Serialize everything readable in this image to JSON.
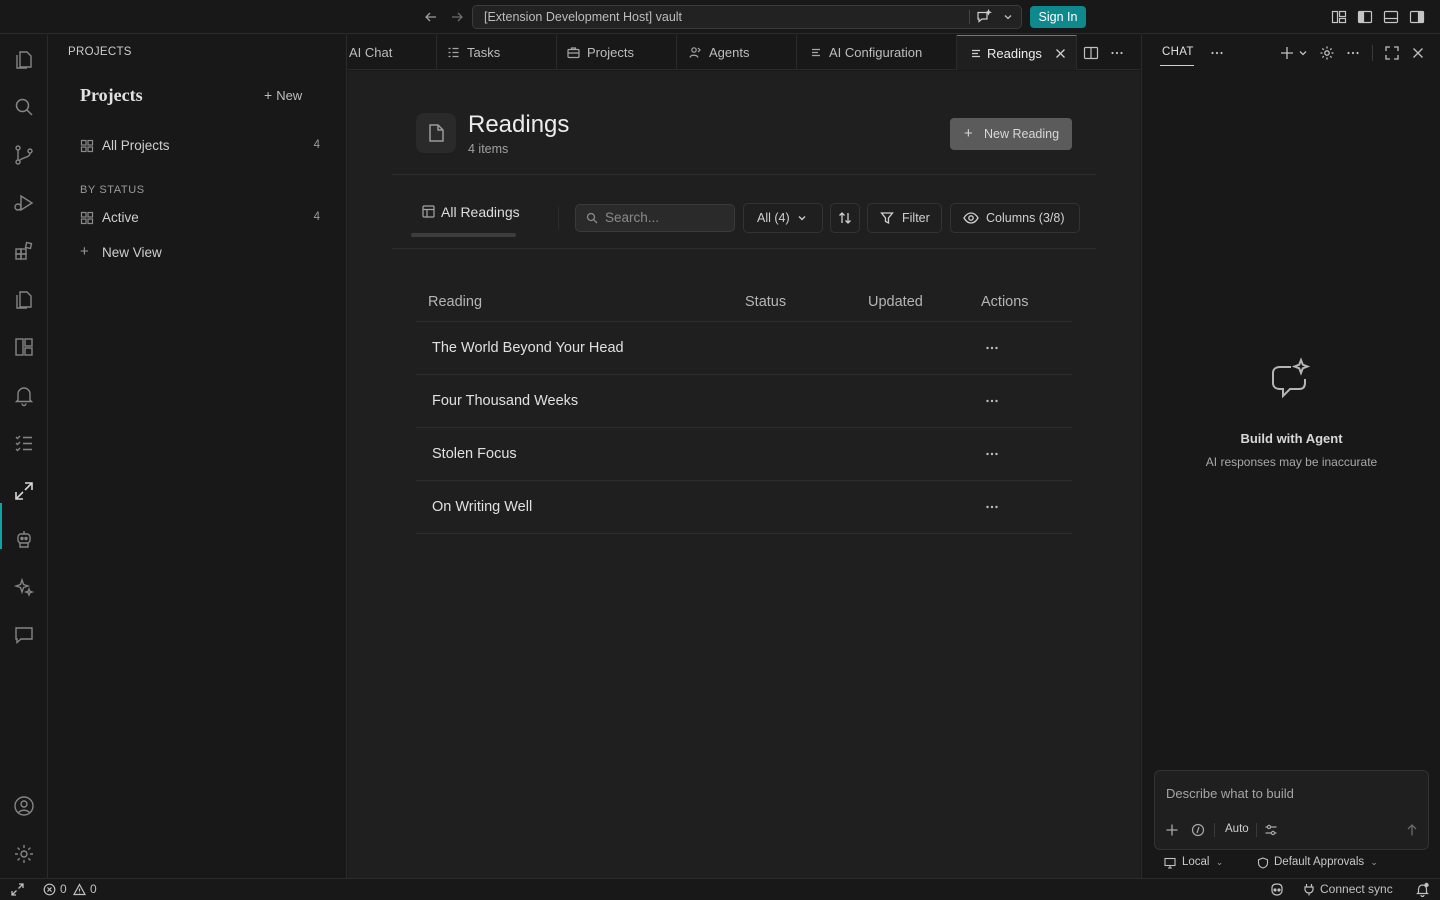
{
  "titlebar": {
    "command_center": "[Extension Development Host] vault",
    "sign_in": "Sign In"
  },
  "activity_bar": {
    "items": [
      "files-icon",
      "search-icon",
      "source-control-icon",
      "run-debug-icon",
      "extensions-icon",
      "pages-icon",
      "dashboard-icon",
      "bell-icon",
      "checklist-icon",
      "remote-icon",
      "robot-icon",
      "sparkles-icon",
      "chat-bubble-icon"
    ],
    "bottom": [
      "account-icon",
      "settings-icon"
    ]
  },
  "sidebar": {
    "title": "PROJECTS",
    "heading": "Projects",
    "new_label": "New",
    "all_projects": {
      "label": "All Projects",
      "count": "4"
    },
    "by_status": "BY STATUS",
    "active": {
      "label": "Active",
      "count": "4"
    },
    "new_view": "New View"
  },
  "tabs": [
    {
      "label": "AI Chat"
    },
    {
      "label": "Tasks"
    },
    {
      "label": "Projects"
    },
    {
      "label": "Agents"
    },
    {
      "label": "AI Configuration"
    },
    {
      "label": "Readings",
      "active": true
    }
  ],
  "page": {
    "title": "Readings",
    "count": "4 items",
    "new_button": "New Reading",
    "view_tab": "All Readings",
    "search_placeholder": "Search...",
    "all_filter": "All (4)",
    "filter": "Filter",
    "columns": "Columns (3/8)"
  },
  "table": {
    "headers": [
      "Reading",
      "Status",
      "Updated",
      "Actions"
    ],
    "rows": [
      {
        "reading": "The World Beyond Your Head"
      },
      {
        "reading": "Four Thousand Weeks"
      },
      {
        "reading": "Stolen Focus"
      },
      {
        "reading": "On Writing Well"
      }
    ]
  },
  "chat": {
    "tab": "CHAT",
    "empty_title": "Build with Agent",
    "empty_subtitle": "AI responses may be inaccurate",
    "input_placeholder": "Describe what to build",
    "mode": "Auto",
    "location": "Local",
    "approvals": "Default Approvals"
  },
  "statusbar": {
    "errors": "0",
    "warnings": "0",
    "sync": "Connect sync"
  },
  "colors": {
    "accent": "#0fa3a8",
    "sign_in_bg": "#0e8a8e",
    "background": "#1f1f1f"
  }
}
